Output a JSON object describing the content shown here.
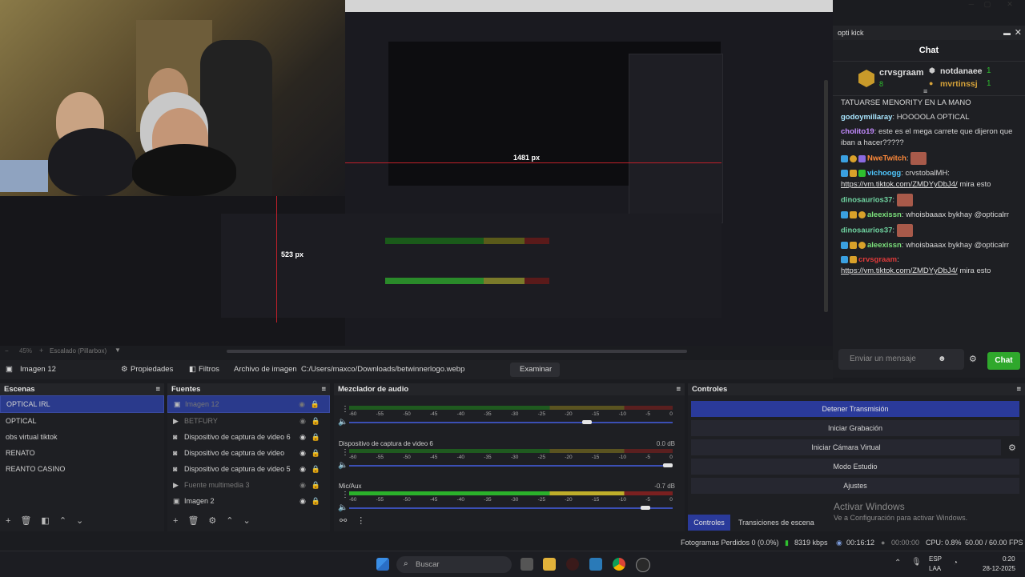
{
  "preview": {
    "nested_px_h": "1481 px",
    "nested_px_v": "523 px"
  },
  "chat": {
    "dock_title": "opti kick",
    "header": "Chat",
    "top_user": "crvsgraam",
    "top_user_count": "8",
    "sub1_name": "notdanaee",
    "sub1_count": "1",
    "sub2_name": "mvrtinssj",
    "sub2_count": "1",
    "messages": [
      {
        "user": "",
        "text": "TATUARSE MENORITY EN LA MANO"
      },
      {
        "user": "godoymillaray",
        "text": ": HOOOOLA OPTICAL"
      },
      {
        "user": "cholito19",
        "text": ": este es el mega carrete que dijeron que iban a hacer?????"
      },
      {
        "user": "NweTwitch",
        "text": ":"
      },
      {
        "user": "vichoogg",
        "text": ": crvstobalMH:",
        "link": "https://vm.tiktok.com/ZMDYyDbJ4/",
        "after": " mira esto"
      },
      {
        "user": "dinosaurios37",
        "text": ":"
      },
      {
        "user": "aleexissn",
        "text": ": whoisbaaax bykhay @opticalrr"
      },
      {
        "user": "dinosaurios37",
        "text": ":"
      },
      {
        "user": "aleexissn",
        "text": ": whoisbaaax bykhay @opticalrr"
      },
      {
        "user": "crvsgraam",
        "text": ":",
        "link": "https://vm.tiktok.com/ZMDYyDbJ4/",
        "after": " mira esto"
      }
    ],
    "input_placeholder": "Enviar un mensaje",
    "send_label": "Chat"
  },
  "zoom": {
    "value": "45%",
    "mode": "Escalado (Pillarbox)"
  },
  "source_bar": {
    "source_name": "Imagen 12",
    "properties": "Propiedades",
    "filters": "Filtros",
    "file_label": "Archivo de imagen",
    "file_path": "C:/Users/maxco/Downloads/betwinnerlogo.webp",
    "browse": "Examinar"
  },
  "scenes": {
    "title": "Escenas",
    "items": [
      "OPTICAL IRL",
      "OPTICAL",
      "obs virtual tiktok",
      "RENATO",
      "REANTO CASINO"
    ]
  },
  "sources": {
    "title": "Fuentes",
    "items": [
      "Imagen 12",
      "BETFURY",
      "Dispositivo de captura de video 6",
      "Dispositivo de captura de video",
      "Dispositivo de captura de video 5",
      "Fuente multimedia 3",
      "Imagen 2"
    ]
  },
  "mixer": {
    "title": "Mezclador de audio",
    "ticks": [
      "-60",
      "-55",
      "-50",
      "-45",
      "-40",
      "-35",
      "-30",
      "-25",
      "-20",
      "-15",
      "-10",
      "-5",
      "0"
    ],
    "channels": [
      {
        "name": "",
        "db": "",
        "level": 0.75
      },
      {
        "name": "Dispositivo de captura de video 6",
        "db": "0.0 dB",
        "level": 1.0
      },
      {
        "name": "Mic/Aux",
        "db": "-0.7 dB",
        "level": 0.93
      }
    ]
  },
  "controls": {
    "title": "Controles",
    "buttons": [
      "Detener Transmisión",
      "Iniciar Grabación",
      "Iniciar Cámara Virtual",
      "Modo Estudio",
      "Ajustes"
    ],
    "tab_controls": "Controles",
    "tab_transitions": "Transiciones de escena"
  },
  "activate": {
    "line1": "Activar Windows",
    "line2": "Ve a Configuración para activar Windows."
  },
  "status": {
    "dropped": "Fotogramas Perdidos 0 (0.0%)",
    "kbps": "8319 kbps",
    "time1": "00:16:12",
    "time2": "00:00:00",
    "cpu": "CPU: 0.8%",
    "fps": "60.00 / 60.00 FPS"
  },
  "taskbar": {
    "search": "Buscar",
    "lang1": "ESP",
    "lang2": "LAA",
    "time": "0:20",
    "date": "28-12-2025"
  }
}
